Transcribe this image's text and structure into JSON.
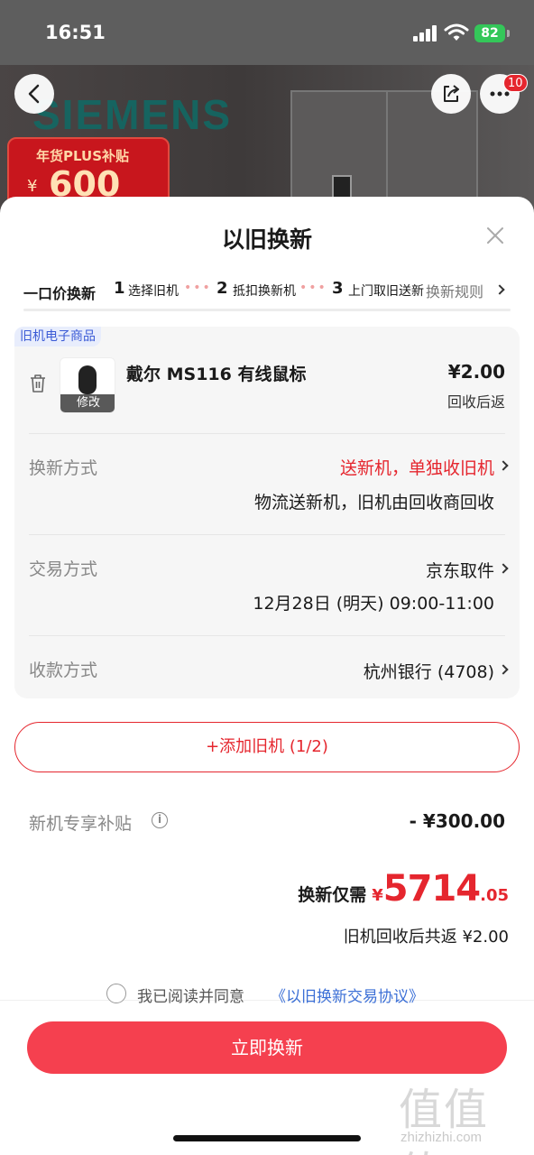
{
  "status_bar": {
    "time": "16:51",
    "battery": "82"
  },
  "background": {
    "brand": "SIEMENS",
    "promo_title": "年货PLUS补贴",
    "promo_currency": "¥",
    "promo_amount": "600",
    "notification_count": "10"
  },
  "sheet": {
    "title": "以旧换新",
    "steps": {
      "main": "一口价换新",
      "items": [
        {
          "num": "1",
          "label": "选择旧机"
        },
        {
          "num": "2",
          "label": "抵扣换新机"
        },
        {
          "num": "3",
          "label": "上门取旧送新"
        }
      ],
      "dots": "•••",
      "rules_link": "换新规则"
    },
    "item": {
      "tag": "旧机电子商品",
      "thumb_edit": "修改",
      "name": "戴尔 MS116 有线鼠标",
      "price": "¥2.00",
      "price_note": "回收后返"
    },
    "rows": [
      {
        "label": "换新方式",
        "value": "送新机，单独收旧机",
        "sub": "物流送新机，旧机由回收商回收"
      },
      {
        "label": "交易方式",
        "value": "京东取件",
        "sub": "12月28日 (明天) 09:00-11:00"
      },
      {
        "label": "收款方式",
        "value": "杭州银行 (4708)",
        "sub": ""
      }
    ],
    "add_button": "+添加旧机 (1/2)",
    "subsidy": {
      "label": "新机专享补贴",
      "value": "- ¥300.00"
    },
    "total": {
      "label": "换新仅需",
      "currency": "¥",
      "integer": "5714",
      "decimal": ".05"
    },
    "recycle_total": "旧机回收后共返 ¥2.00",
    "agreement": {
      "text": "我已阅读并同意",
      "link": "《以旧换新交易协议》"
    },
    "cta": "立即换新"
  },
  "watermark": {
    "big": "值值值",
    "small": "zhizhizhi.com"
  },
  "colors": {
    "accent_red": "#e5262e",
    "cta_red": "#f5404f",
    "tag_blue": "#3b5bd6",
    "link_blue": "#3b6fd6"
  }
}
